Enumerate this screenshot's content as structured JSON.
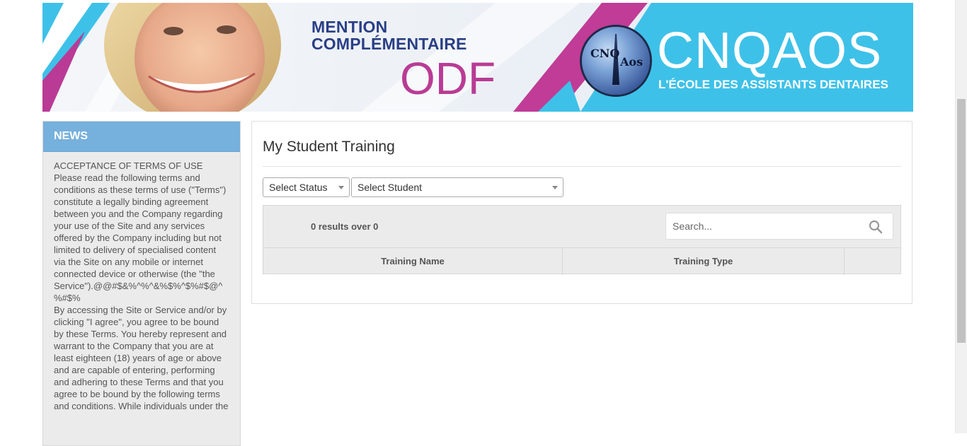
{
  "banner": {
    "title_line1": "MENTION",
    "title_line2": "COMPLÉMENTAIRE",
    "program": "ODF",
    "brand": "CNQAOS",
    "tagline": "L'ÉCOLE DES ASSISTANTS DENTAIRES",
    "logo_left": "CNQ",
    "logo_right": "Aos"
  },
  "news": {
    "header": "NEWS",
    "body": "ACCEPTANCE OF TERMS OF USE\nPlease read the following terms and conditions as these terms of use (\"Terms\") constitute a legally binding agreement between you and the Company regarding your use of the Site and any services offered by the Company including but not limited to delivery of specialised content via the Site on any mobile or internet connected device or otherwise (the \"the Service\").@@#$&%^%^&%$%^$%#$@^%#$%\nBy accessing the Site or Service and/or by clicking \"I agree\", you agree to be bound by these Terms. You hereby represent and warrant to the Company that you are at least eighteen (18) years of age or above and are capable of entering, performing and adhering to these Terms and that you agree to be bound by the following terms and conditions. While individuals under the"
  },
  "main": {
    "title": "My Student Training",
    "status_select": "Select Status",
    "student_select": "Select Student",
    "results_text": "0 results over  0",
    "search_placeholder": "Search...",
    "columns": [
      "Training Name",
      "Training Type",
      ""
    ]
  },
  "colors": {
    "news_header": "#76b0dc",
    "banner_blue": "#3ec1e8",
    "banner_magenta": "#b93b95",
    "banner_navy": "#2a3f86"
  }
}
